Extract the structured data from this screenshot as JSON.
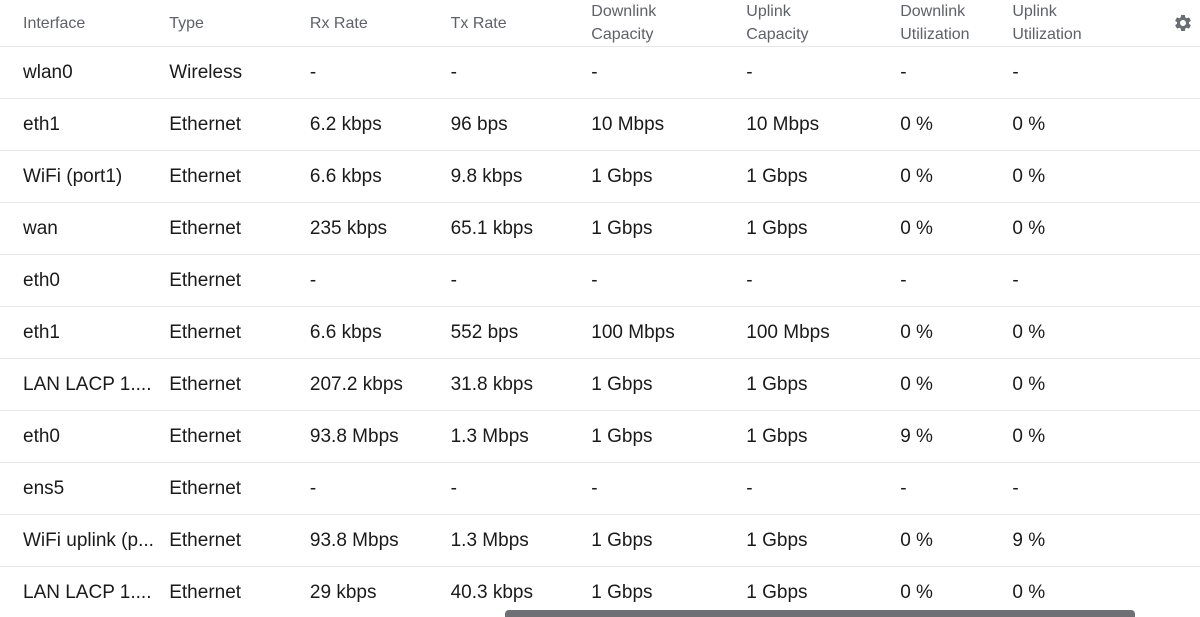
{
  "table": {
    "headers": {
      "interface": "Interface",
      "type": "Type",
      "rx_rate": "Rx Rate",
      "tx_rate": "Tx Rate",
      "downlink_capacity_l1": "Downlink",
      "downlink_capacity_l2": "Capacity",
      "uplink_capacity_l1": "Uplink",
      "uplink_capacity_l2": "Capacity",
      "downlink_util_l1": "Downlink",
      "downlink_util_l2": "Utilization",
      "uplink_util_l1": "Uplink",
      "uplink_util_l2": "Utilization"
    },
    "settings_icon": "gear-icon",
    "rows": [
      {
        "interface": "wlan0",
        "type": "Wireless",
        "rx": "-",
        "tx": "-",
        "dcap": "-",
        "ucap": "-",
        "dutil": "-",
        "uutil": "-"
      },
      {
        "interface": "eth1",
        "type": "Ethernet",
        "rx": "6.2 kbps",
        "tx": "96 bps",
        "dcap": "10 Mbps",
        "ucap": "10 Mbps",
        "dutil": "0 %",
        "uutil": "0 %"
      },
      {
        "interface": "WiFi (port1)",
        "type": "Ethernet",
        "rx": "6.6 kbps",
        "tx": "9.8 kbps",
        "dcap": "1 Gbps",
        "ucap": "1 Gbps",
        "dutil": "0 %",
        "uutil": "0 %"
      },
      {
        "interface": "wan",
        "type": "Ethernet",
        "rx": "235 kbps",
        "tx": "65.1 kbps",
        "dcap": "1 Gbps",
        "ucap": "1 Gbps",
        "dutil": "0 %",
        "uutil": "0 %"
      },
      {
        "interface": "eth0",
        "type": "Ethernet",
        "rx": "-",
        "tx": "-",
        "dcap": "-",
        "ucap": "-",
        "dutil": "-",
        "uutil": "-"
      },
      {
        "interface": "eth1",
        "type": "Ethernet",
        "rx": "6.6 kbps",
        "tx": "552 bps",
        "dcap": "100 Mbps",
        "ucap": "100 Mbps",
        "dutil": "0 %",
        "uutil": "0 %"
      },
      {
        "interface": "LAN LACP 1....",
        "type": "Ethernet",
        "rx": "207.2 kbps",
        "tx": "31.8 kbps",
        "dcap": "1 Gbps",
        "ucap": "1 Gbps",
        "dutil": "0 %",
        "uutil": "0 %"
      },
      {
        "interface": "eth0",
        "type": "Ethernet",
        "rx": "93.8 Mbps",
        "tx": "1.3 Mbps",
        "dcap": "1 Gbps",
        "ucap": "1 Gbps",
        "dutil": "9 %",
        "uutil": "0 %"
      },
      {
        "interface": "ens5",
        "type": "Ethernet",
        "rx": "-",
        "tx": "-",
        "dcap": "-",
        "ucap": "-",
        "dutil": "-",
        "uutil": "-"
      },
      {
        "interface": "WiFi uplink (p...",
        "type": "Ethernet",
        "rx": "93.8 Mbps",
        "tx": "1.3 Mbps",
        "dcap": "1 Gbps",
        "ucap": "1 Gbps",
        "dutil": "0 %",
        "uutil": "9 %"
      },
      {
        "interface": "LAN LACP 1....",
        "type": "Ethernet",
        "rx": "29 kbps",
        "tx": "40.3 kbps",
        "dcap": "1 Gbps",
        "ucap": "1 Gbps",
        "dutil": "0 %",
        "uutil": "0 %"
      }
    ]
  },
  "colors": {
    "header_text": "#5f6168",
    "cell_text": "#1a1a1a",
    "row_divider": "#e8e8e8",
    "gear": "#6b6d74",
    "scrollbar": "#6f7076"
  }
}
